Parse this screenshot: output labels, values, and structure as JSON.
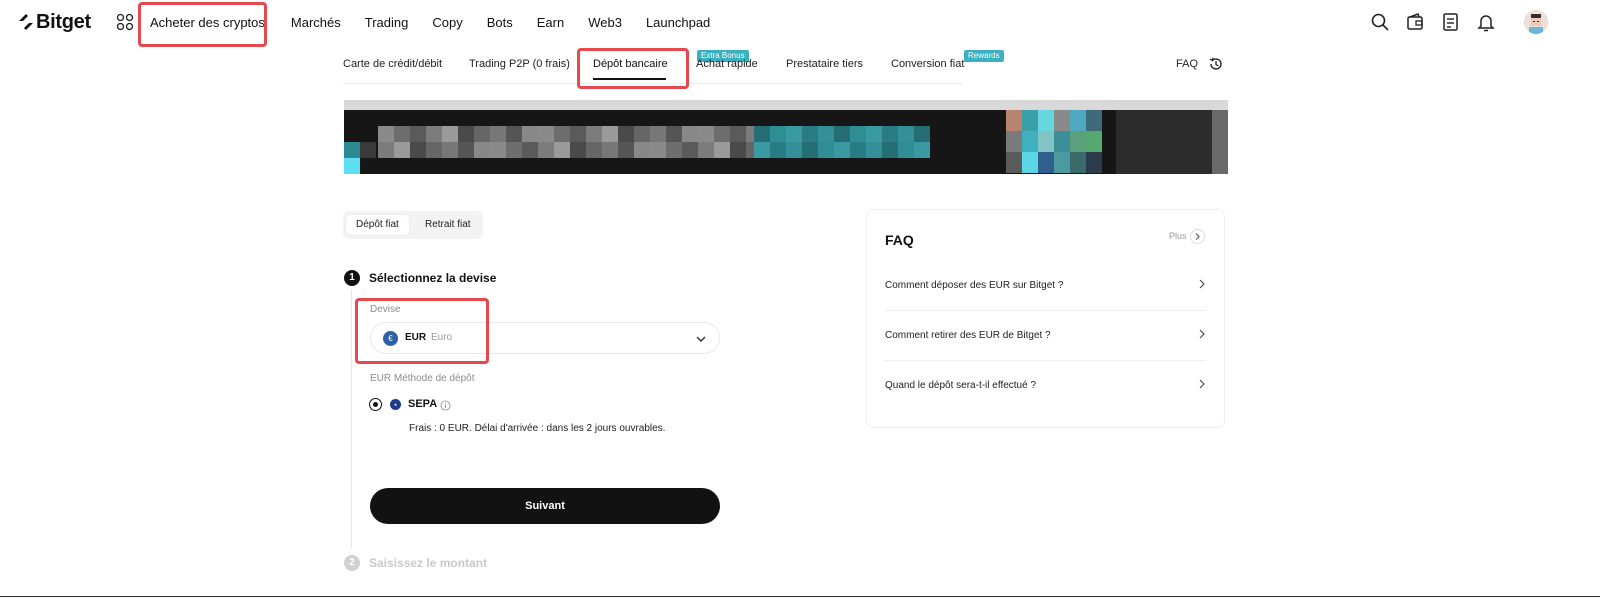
{
  "brand": {
    "name": "Bitget"
  },
  "nav": {
    "items": [
      "Acheter des cryptos",
      "Marchés",
      "Trading",
      "Copy",
      "Bots",
      "Earn",
      "Web3",
      "Launchpad"
    ]
  },
  "subtabs": {
    "items": [
      "Carte de crédit/débit",
      "Trading P2P (0 frais)",
      "Dépôt bancaire",
      "Achat rapide",
      "Prestataire tiers",
      "Conversion fiat"
    ],
    "active": "Dépôt bancaire",
    "badges": {
      "extra": "Extra Bonus",
      "rewards": "Rewards"
    },
    "faq_link": "FAQ"
  },
  "segment": {
    "deposit": "Dépôt fiat",
    "withdraw": "Retrait fiat"
  },
  "step1": {
    "number": "1",
    "title": "Sélectionnez la devise",
    "currency_label": "Devise",
    "currency_code": "EUR",
    "currency_name": "Euro",
    "currency_symbol": "€",
    "method_label": "EUR Méthode de dépôt",
    "method_name": "SEPA",
    "fee_text": "Frais : 0 EUR. Délai d'arrivée : dans les 2 jours ouvrables.",
    "next_button": "Suivant"
  },
  "step2": {
    "number": "2",
    "title": "Saisissez le montant"
  },
  "faq": {
    "title": "FAQ",
    "more": "Plus",
    "questions": [
      "Comment déposer des EUR sur Bitget ?",
      "Comment retirer des EUR de Bitget ?",
      "Quand le dépôt sera-t-il effectué ?"
    ]
  },
  "colors": {
    "accent": "#3bb0c1",
    "primary": "#121212",
    "highlight": "#e5484d"
  }
}
